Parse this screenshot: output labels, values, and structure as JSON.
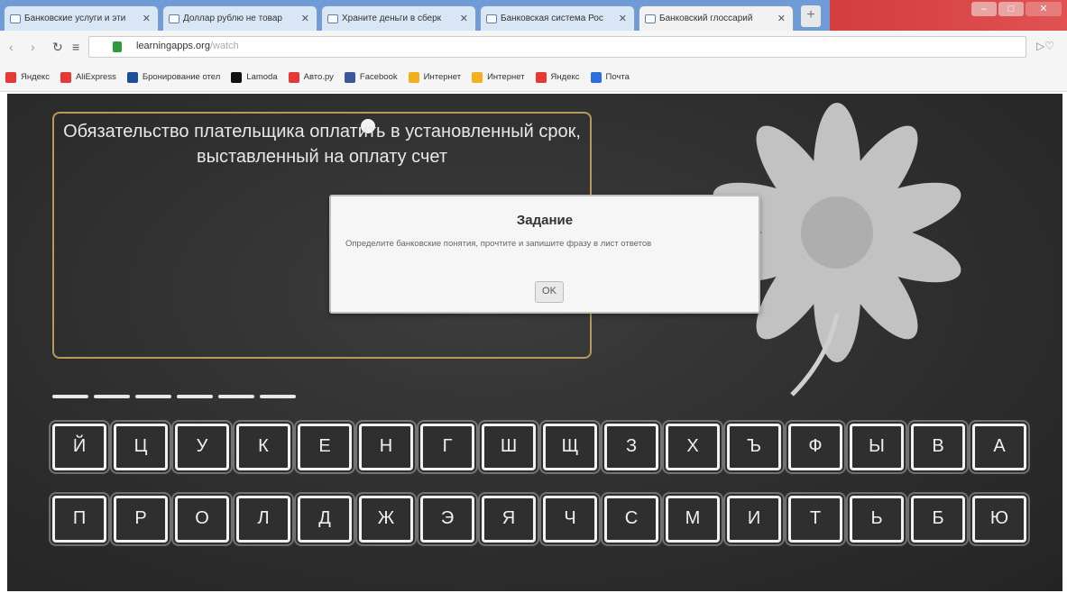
{
  "browser": {
    "tabs": [
      {
        "title": "Банковские услуги и эти",
        "active": false
      },
      {
        "title": "Доллар рублю не товар",
        "active": false
      },
      {
        "title": "Храните деньги в сберк",
        "active": false
      },
      {
        "title": "Банковская система Рос",
        "active": false
      },
      {
        "title": "Банковский глоссарий",
        "active": true
      }
    ],
    "url_host": "learningapps.org",
    "url_path": "/watch",
    "bookmarks": [
      {
        "label": "Яндекс",
        "color": "#e53935"
      },
      {
        "label": "AliExpress",
        "color": "#e53935"
      },
      {
        "label": "Бронирование отел",
        "color": "#1e4d9b"
      },
      {
        "label": "Lamoda",
        "color": "#111111"
      },
      {
        "label": "Авто.ру",
        "color": "#e53935"
      },
      {
        "label": "Facebook",
        "color": "#3b5998"
      },
      {
        "label": "Интернет",
        "color": "#f2b01e"
      },
      {
        "label": "Интернет",
        "color": "#f2b01e"
      },
      {
        "label": "Яндекс",
        "color": "#e53935"
      },
      {
        "label": "Почта",
        "color": "#2a6fdb"
      }
    ]
  },
  "game": {
    "definition": "Обязательство плательщика оплатить в установленный срок, выставленный на оплату счет",
    "answer_length": 6,
    "keyboard_row1": [
      "Й",
      "Ц",
      "У",
      "К",
      "Е",
      "Н",
      "Г",
      "Ш",
      "Щ",
      "З",
      "Х",
      "Ъ",
      "Ф",
      "Ы",
      "В",
      "А"
    ],
    "keyboard_row2": [
      "П",
      "Р",
      "О",
      "Л",
      "Д",
      "Ж",
      "Э",
      "Я",
      "Ч",
      "С",
      "М",
      "И",
      "Т",
      "Ь",
      "Б",
      "Ю"
    ]
  },
  "modal": {
    "title": "Задание",
    "message": "Определите банковские понятия, прочтите и запишите фразу в лист ответов",
    "ok_label": "OK"
  }
}
